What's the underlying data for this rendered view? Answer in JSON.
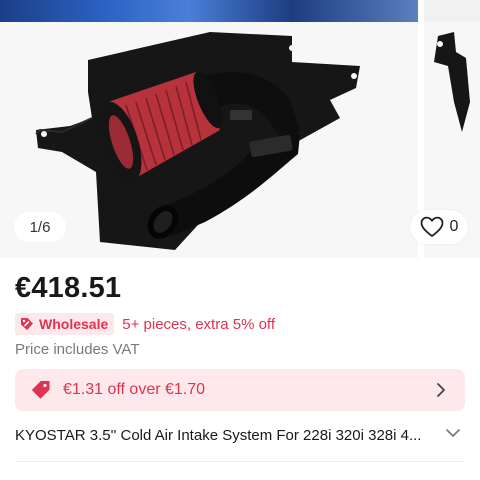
{
  "gallery": {
    "counter": "1/6",
    "favorite_count": "0",
    "icons": {
      "favorite": "heart-outline-icon"
    }
  },
  "product": {
    "price": "€418.51",
    "wholesale_badge": "Wholesale",
    "wholesale_text": "5+ pieces, extra 5% off",
    "vat_note": "Price includes VAT",
    "title": "KYOSTAR 3.5'' Cold Air Intake System For 228i 320i 328i 4..."
  },
  "coupon": {
    "text": "€1.31 off over €1.70",
    "icon": "price-tag-icon"
  },
  "colors": {
    "accent": "#e0334f",
    "accent_bg": "#fde9ec",
    "text_primary": "#191919",
    "text_secondary": "#7a7a7a",
    "filter_red": "#b8323c"
  }
}
